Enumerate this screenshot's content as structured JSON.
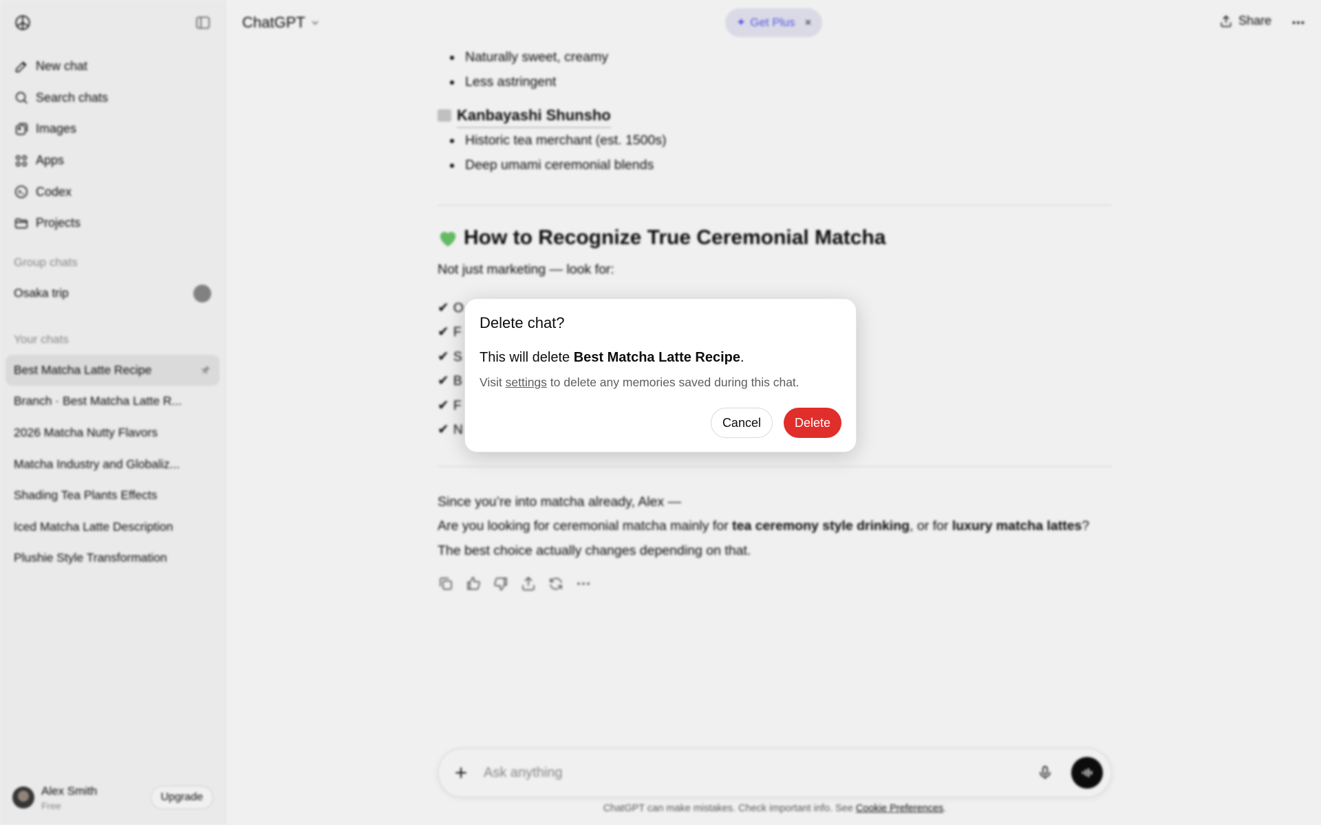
{
  "app": {
    "model_name": "ChatGPT"
  },
  "header": {
    "get_plus": "Get Plus",
    "share": "Share"
  },
  "sidebar": {
    "nav": [
      {
        "label": "New chat",
        "icon": "edit-icon"
      },
      {
        "label": "Search chats",
        "icon": "search-icon"
      },
      {
        "label": "Images",
        "icon": "images-icon"
      },
      {
        "label": "Apps",
        "icon": "apps-icon"
      },
      {
        "label": "Codex",
        "icon": "codex-icon"
      },
      {
        "label": "Projects",
        "icon": "folder-icon"
      }
    ],
    "group_chats_title": "Group chats",
    "group_chats": [
      {
        "label": "Osaka trip"
      }
    ],
    "your_chats_title": "Your chats",
    "chats": [
      {
        "label": "Best Matcha Latte Recipe",
        "active": true
      },
      {
        "label": "Branch · Best Matcha Latte R..."
      },
      {
        "label": "2026 Matcha Nutty Flavors"
      },
      {
        "label": "Matcha Industry and Globaliz..."
      },
      {
        "label": "Shading Tea Plants Effects"
      },
      {
        "label": "Iced Matcha Latte Description"
      },
      {
        "label": "Plushie Style Transformation"
      }
    ],
    "user": {
      "name": "Alex Smith",
      "plan": "Free",
      "upgrade": "Upgrade"
    }
  },
  "conversation": {
    "bullets_top": [
      "Naturally sweet, creamy",
      "Less astringent"
    ],
    "brand_heading": "Kanbayashi Shunsho",
    "brand_bullets": [
      "Historic tea merchant (est. 1500s)",
      "Deep umami ceremonial blends"
    ],
    "section_heading": "How to Recognize True Ceremonial Matcha",
    "section_intro": "Not just marketing — look for:",
    "checks": [
      "O",
      "F",
      "S",
      "B",
      "F",
      "N"
    ],
    "closing": {
      "line1": "Since you’re into matcha already, Alex —",
      "line2_a": "Are you looking for ceremonial matcha mainly for ",
      "line2_b": "tea ceremony style drinking",
      "line2_c": ", or for ",
      "line2_d": "luxury matcha lattes",
      "line2_e": "?",
      "line3": "The best choice actually changes depending on that."
    }
  },
  "composer": {
    "placeholder": "Ask anything"
  },
  "footer": {
    "disclaimer": "ChatGPT can make mistakes. Check important info. See ",
    "link": "Cookie Preferences",
    "end": "."
  },
  "modal": {
    "title": "Delete chat?",
    "body_prefix": "This will delete ",
    "body_target": "Best Matcha Latte Recipe",
    "body_suffix": ".",
    "sub_prefix": "Visit ",
    "sub_link": "settings",
    "sub_suffix": " to delete any memories saved during this chat.",
    "cancel": "Cancel",
    "delete": "Delete"
  },
  "colors": {
    "danger": "#e02e2a",
    "plus_accent": "#5d5fef"
  }
}
